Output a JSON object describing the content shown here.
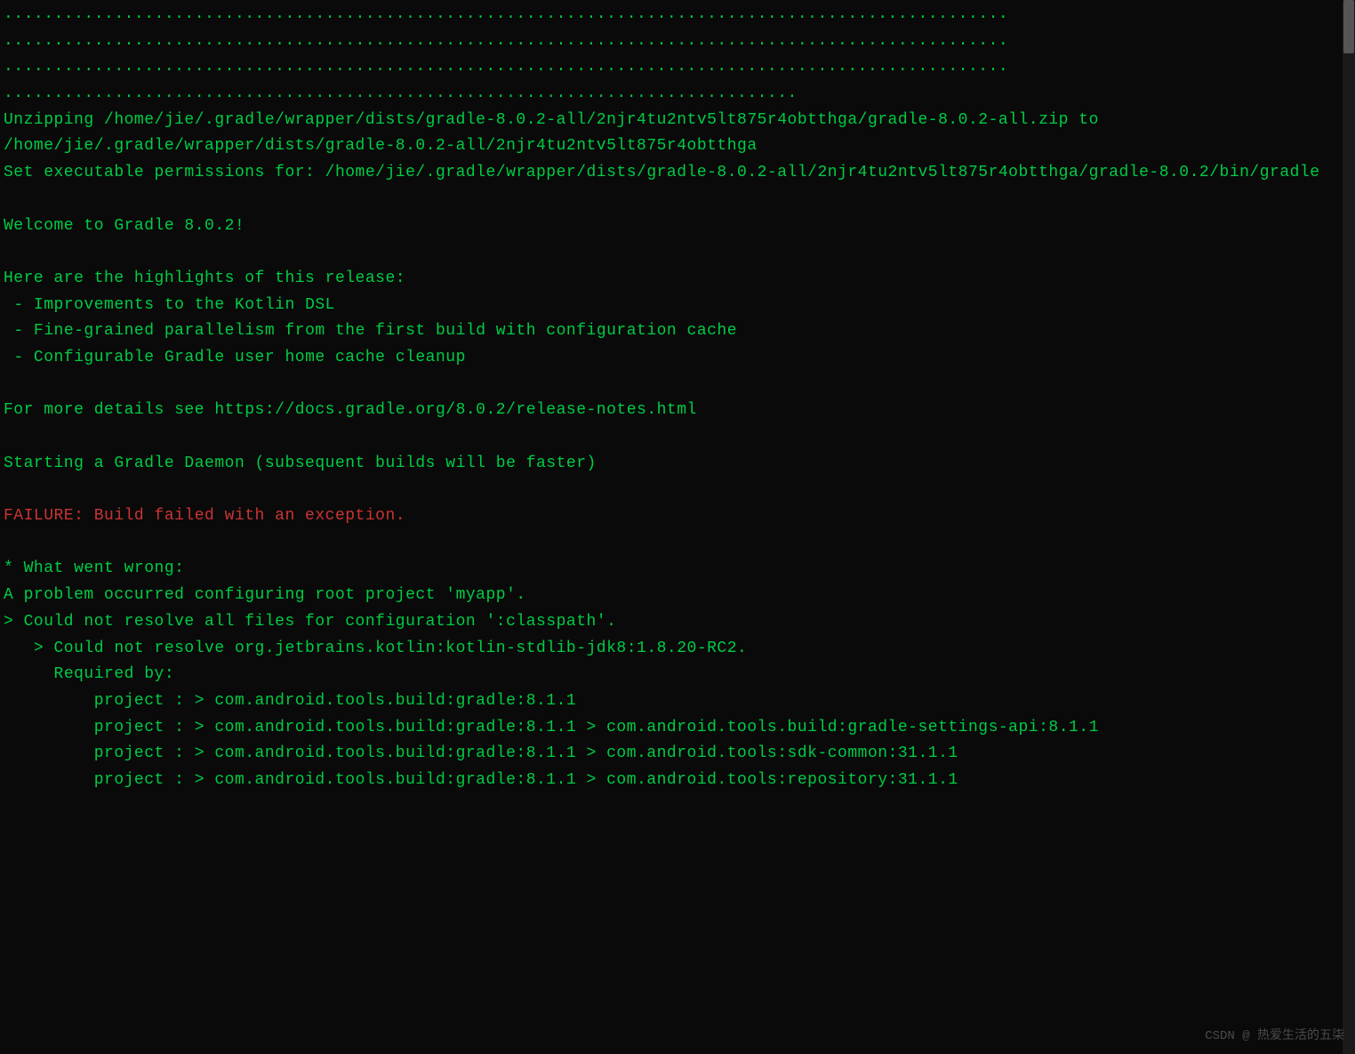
{
  "lines": [
    {
      "cls": "line",
      "text": "...................................................................................................."
    },
    {
      "cls": "line",
      "text": "...................................................................................................."
    },
    {
      "cls": "line",
      "text": "...................................................................................................."
    },
    {
      "cls": "line",
      "text": "..............................................................................."
    },
    {
      "cls": "line",
      "text": "Unzipping /home/jie/.gradle/wrapper/dists/gradle-8.0.2-all/2njr4tu2ntv5lt875r4obtthga/gradle-8.0.2-all.zip to /home/jie/.gradle/wrapper/dists/gradle-8.0.2-all/2njr4tu2ntv5lt875r4obtthga"
    },
    {
      "cls": "line",
      "text": "Set executable permissions for: /home/jie/.gradle/wrapper/dists/gradle-8.0.2-all/2njr4tu2ntv5lt875r4obtthga/gradle-8.0.2/bin/gradle"
    },
    {
      "cls": "line empty",
      "text": ""
    },
    {
      "cls": "line",
      "text": "Welcome to Gradle 8.0.2!"
    },
    {
      "cls": "line empty",
      "text": ""
    },
    {
      "cls": "line",
      "text": "Here are the highlights of this release:"
    },
    {
      "cls": "line",
      "text": " - Improvements to the Kotlin DSL"
    },
    {
      "cls": "line",
      "text": " - Fine-grained parallelism from the first build with configuration cache"
    },
    {
      "cls": "line",
      "text": " - Configurable Gradle user home cache cleanup"
    },
    {
      "cls": "line empty",
      "text": ""
    },
    {
      "cls": "line",
      "text": "For more details see https://docs.gradle.org/8.0.2/release-notes.html"
    },
    {
      "cls": "line empty",
      "text": ""
    },
    {
      "cls": "line",
      "text": "Starting a Gradle Daemon (subsequent builds will be faster)"
    },
    {
      "cls": "line empty",
      "text": ""
    },
    {
      "cls": "line error",
      "text": "FAILURE: Build failed with an exception."
    },
    {
      "cls": "line empty",
      "text": ""
    },
    {
      "cls": "line",
      "text": "* What went wrong:"
    },
    {
      "cls": "line",
      "text": "A problem occurred configuring root project 'myapp'."
    },
    {
      "cls": "line",
      "text": "> Could not resolve all files for configuration ':classpath'."
    },
    {
      "cls": "line",
      "text": "   > Could not resolve org.jetbrains.kotlin:kotlin-stdlib-jdk8:1.8.20-RC2."
    },
    {
      "cls": "line",
      "text": "     Required by:"
    },
    {
      "cls": "line",
      "text": "         project : > com.android.tools.build:gradle:8.1.1"
    },
    {
      "cls": "line",
      "text": "         project : > com.android.tools.build:gradle:8.1.1 > com.android.tools.build:gradle-settings-api:8.1.1"
    },
    {
      "cls": "line",
      "text": "         project : > com.android.tools.build:gradle:8.1.1 > com.android.tools:sdk-common:31.1.1"
    },
    {
      "cls": "line",
      "text": "         project : > com.android.tools.build:gradle:8.1.1 > com.android.tools:repository:31.1.1"
    }
  ],
  "watermark": "CSDN @ 热爱生活的五柒"
}
